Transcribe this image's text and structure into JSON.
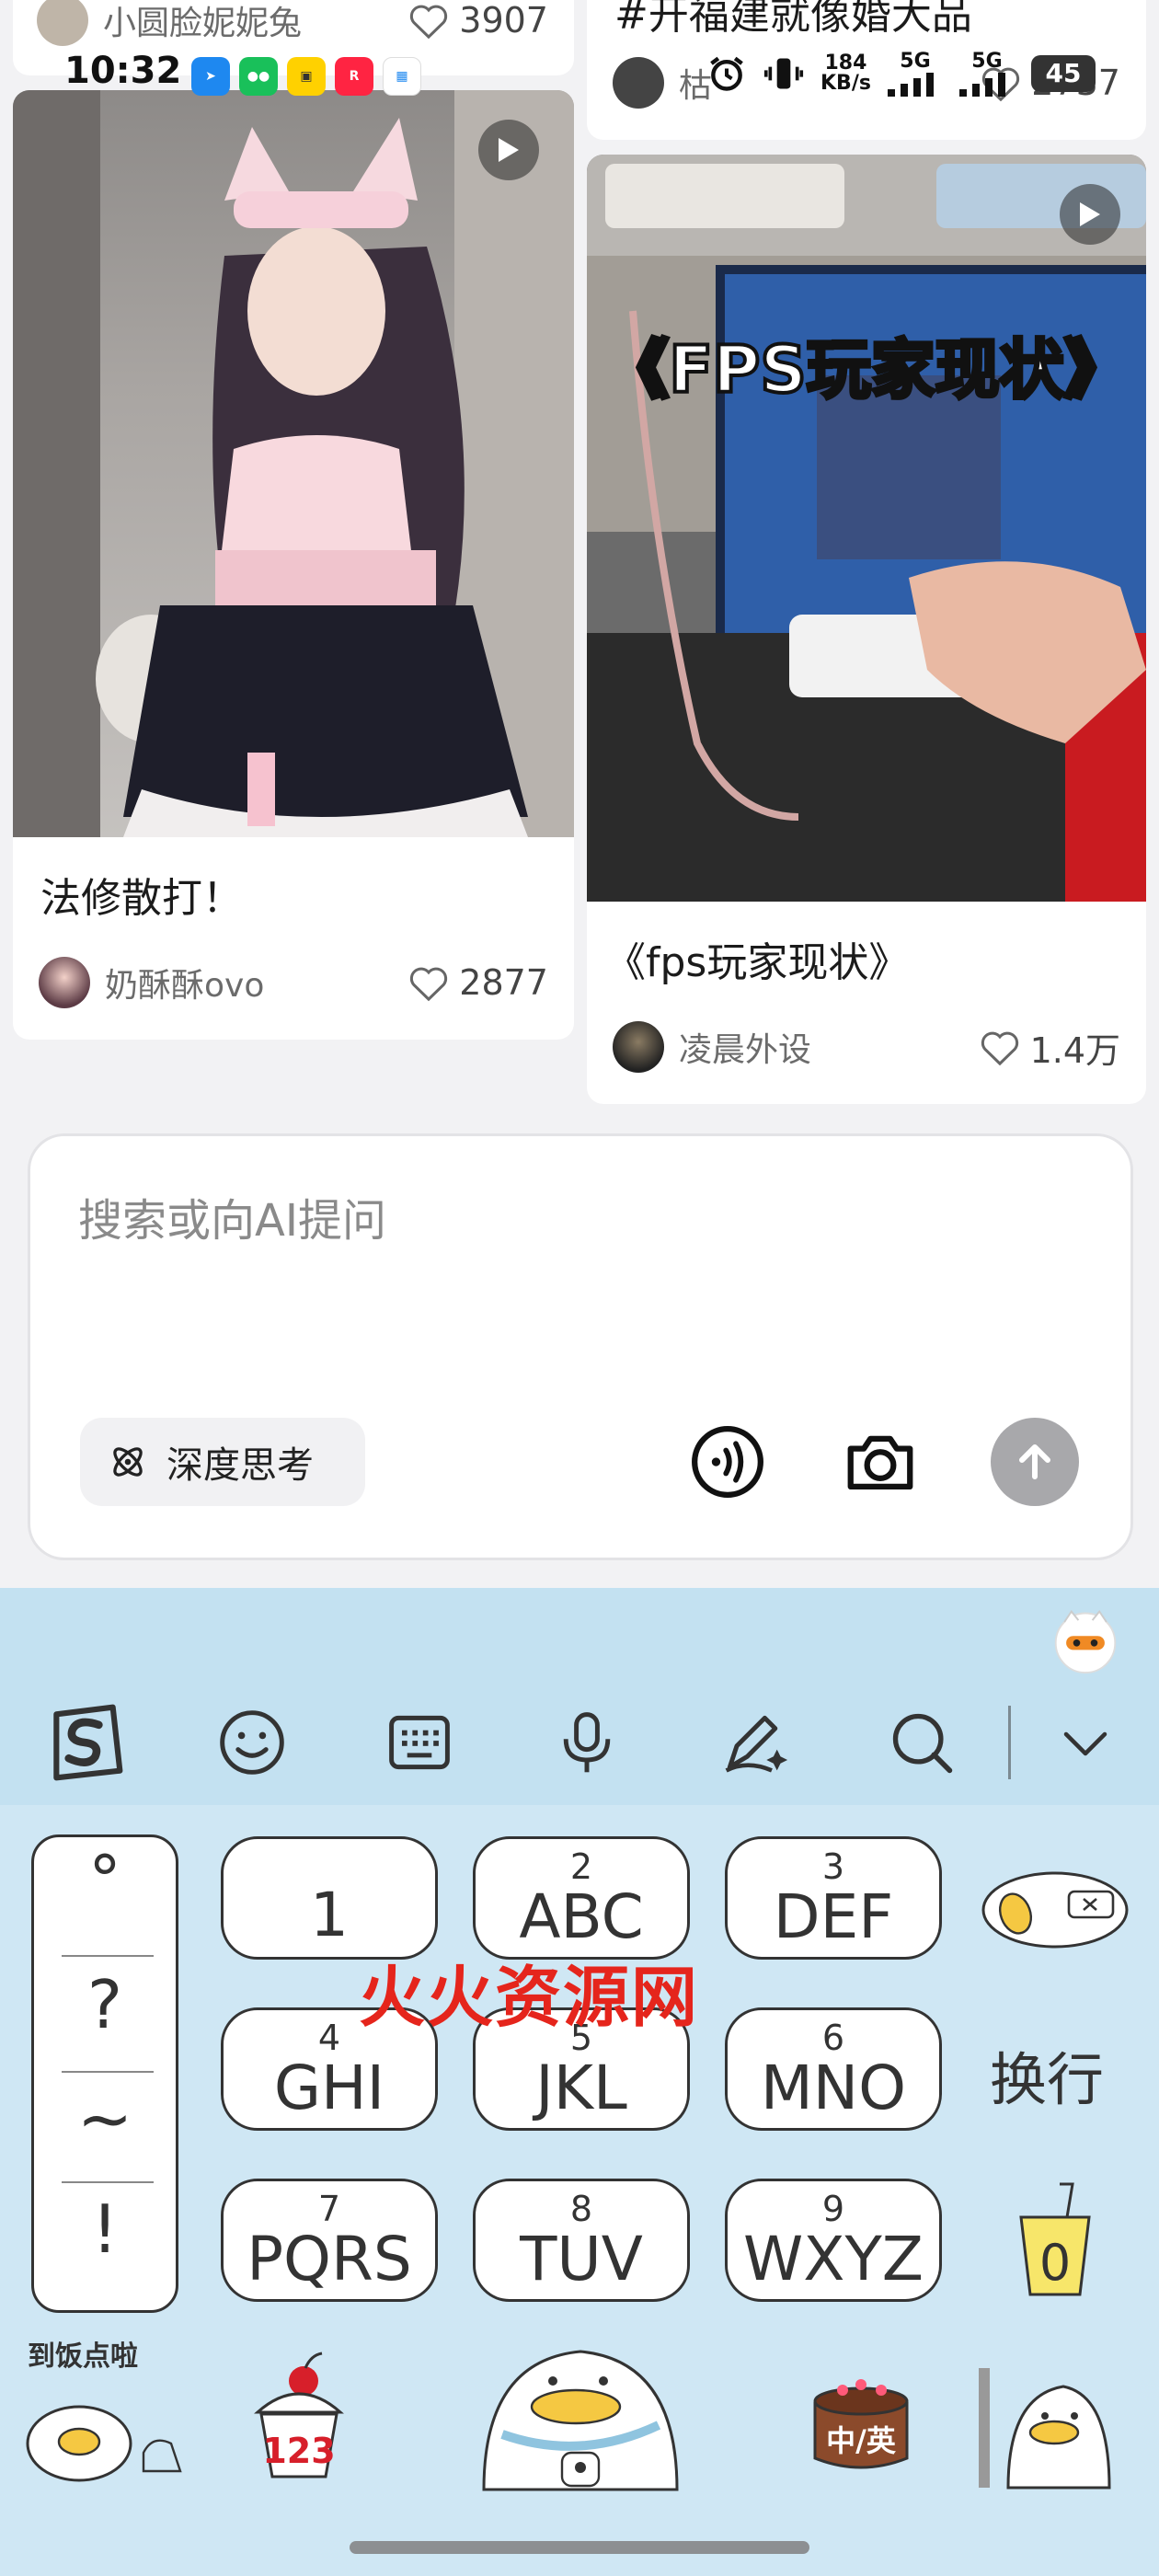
{
  "status_bar": {
    "time": "10:32",
    "net_speed_value": "184",
    "net_speed_unit": "KB/s",
    "sig1": "5G",
    "sig2": "5G",
    "battery": "45"
  },
  "feed": {
    "top_left_partial": {
      "author": "小圆脸妮妮兔",
      "likes": "3907"
    },
    "top_right_partial": {
      "title": "#开福建就像婚大品",
      "author": "枯",
      "likes": "2737"
    },
    "card_left": {
      "title": "法修散打！",
      "author": "奶酥酥ovo",
      "likes": "2877"
    },
    "card_right": {
      "title": "《fps玩家现状》",
      "overlay_text": "《FPS玩家现状》",
      "author": "凌晨外设",
      "likes": "1.4万"
    }
  },
  "search": {
    "placeholder": "搜索或向AI提问",
    "deep_think_label": "深度思考"
  },
  "keyboard": {
    "symbols": [
      "°",
      "?",
      "~",
      "!"
    ],
    "keys": [
      {
        "num": "",
        "letters": "1"
      },
      {
        "num": "2",
        "letters": "ABC"
      },
      {
        "num": "3",
        "letters": "DEF"
      },
      {
        "num": "4",
        "letters": "GHI"
      },
      {
        "num": "5",
        "letters": "JKL"
      },
      {
        "num": "6",
        "letters": "MNO"
      },
      {
        "num": "7",
        "letters": "PQRS"
      },
      {
        "num": "8",
        "letters": "TUV"
      },
      {
        "num": "9",
        "letters": "WXYZ"
      }
    ],
    "enter_label": "换行",
    "zero_label": "0",
    "num_mode_label": "123",
    "lang_label": "中/英",
    "sticker_text": "到饭点啦",
    "watermark": "火火资源网"
  }
}
